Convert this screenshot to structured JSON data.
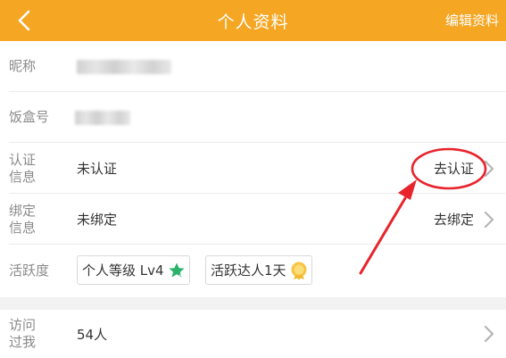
{
  "header": {
    "title": "个人资料",
    "edit_label": "编辑资料",
    "back_icon": "chevron-left-icon",
    "bg_color": "#f5a623"
  },
  "profile": {
    "nickname": {
      "label": "昵称"
    },
    "box_id": {
      "label": "饭盒号"
    },
    "verification": {
      "label": "认证\n信息",
      "value": "未认证",
      "action": "去认证"
    },
    "binding": {
      "label": "绑定\n信息",
      "value": "未绑定",
      "action": "去绑定"
    },
    "activity": {
      "label": "活跃度",
      "badges": [
        {
          "text": "个人等级 Lv4",
          "icon": "star-icon"
        },
        {
          "text": "活跃达人1天",
          "icon": "medal-icon"
        }
      ]
    }
  },
  "visits": {
    "label": "访问\n过我",
    "value": "54人"
  },
  "annotation_color": "#e8232b"
}
